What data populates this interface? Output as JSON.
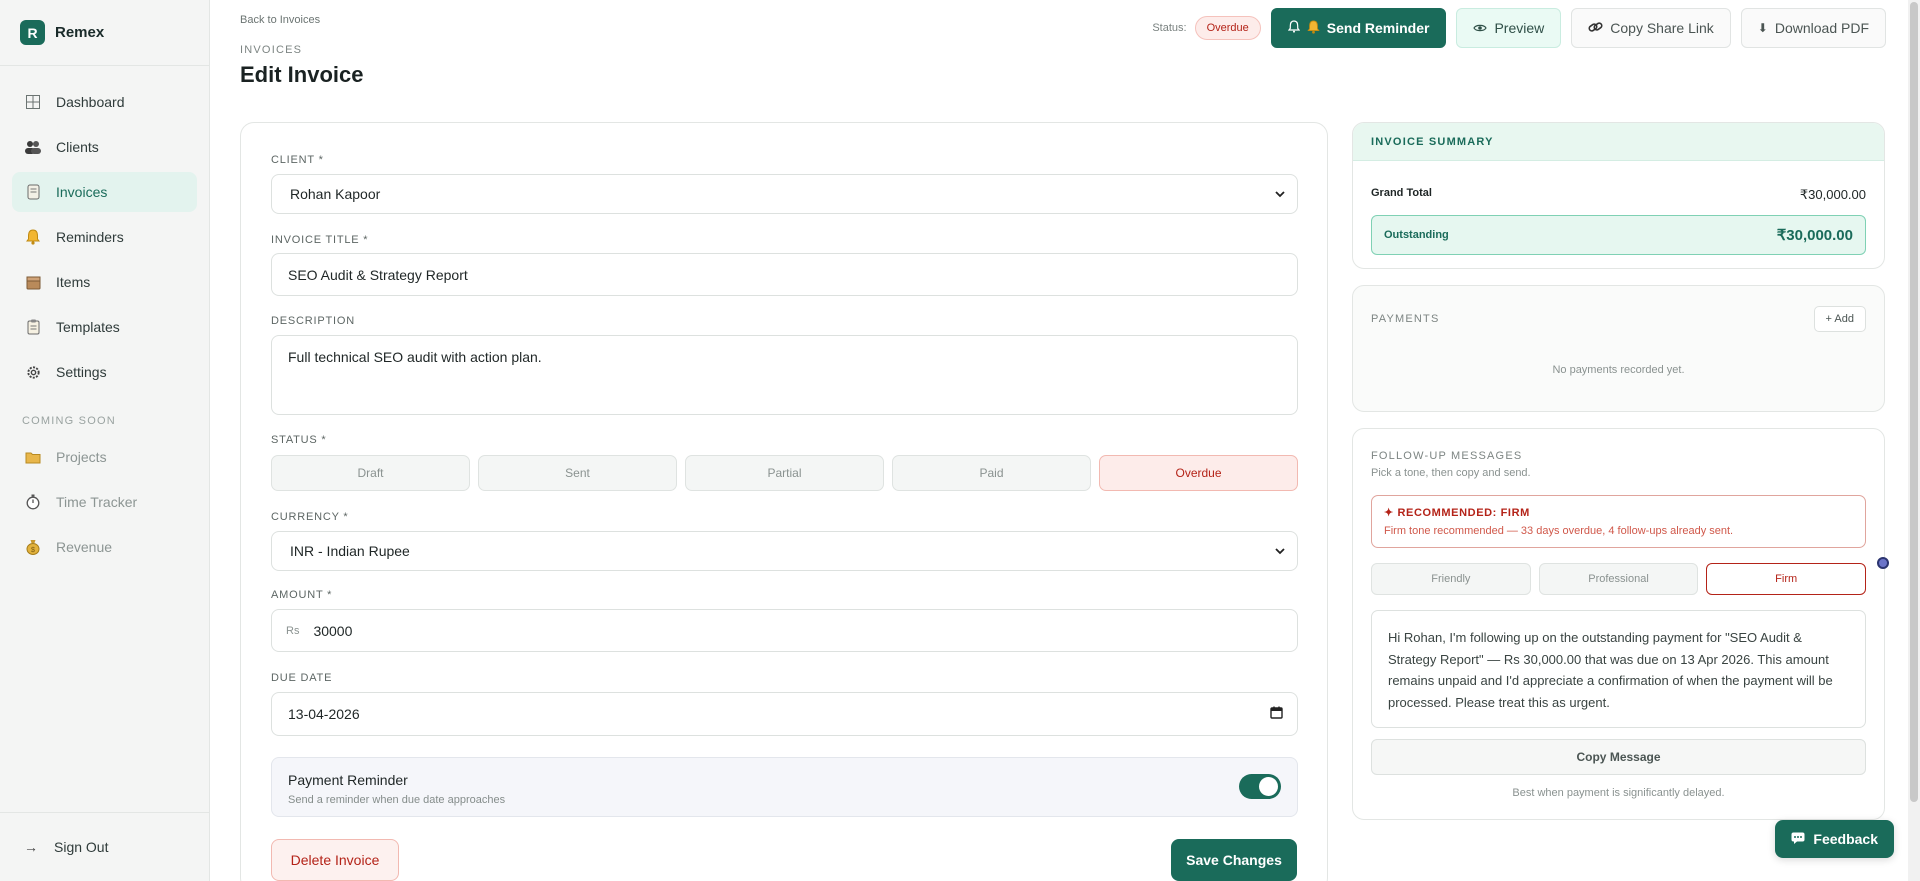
{
  "brand": {
    "logo_letter": "R",
    "name": "Remex"
  },
  "sidebar": {
    "items": [
      {
        "label": "Dashboard"
      },
      {
        "label": "Clients"
      },
      {
        "label": "Invoices"
      },
      {
        "label": "Reminders"
      },
      {
        "label": "Items"
      },
      {
        "label": "Templates"
      },
      {
        "label": "Settings"
      }
    ],
    "coming_soon_label": "COMING SOON",
    "coming_soon": [
      {
        "label": "Projects"
      },
      {
        "label": "Time Tracker"
      },
      {
        "label": "Revenue"
      }
    ],
    "sign_out": "Sign Out"
  },
  "header": {
    "back_link": "Back to Invoices",
    "breadcrumb": "INVOICES",
    "title": "Edit Invoice",
    "status_label": "Status:",
    "status_value": "Overdue",
    "send_reminder": "Send Reminder",
    "preview": "Preview",
    "copy_share_link": "Copy Share Link",
    "download_pdf": "Download PDF"
  },
  "form": {
    "client_label": "CLIENT *",
    "client_value": "Rohan Kapoor",
    "title_label": "INVOICE TITLE *",
    "title_value": "SEO Audit & Strategy Report",
    "description_label": "DESCRIPTION",
    "description_value": "Full technical SEO audit with action plan.",
    "status_label": "STATUS *",
    "status_options": [
      "Draft",
      "Sent",
      "Partial",
      "Paid",
      "Overdue"
    ],
    "status_selected": "Overdue",
    "currency_label": "CURRENCY *",
    "currency_value": "INR - Indian Rupee",
    "amount_label": "AMOUNT *",
    "amount_prefix": "Rs",
    "amount_value": "30000",
    "due_label": "DUE DATE",
    "due_value": "13-04-2026",
    "reminder_title": "Payment Reminder",
    "reminder_sub": "Send a reminder when due date approaches",
    "reminder_on": true,
    "delete_label": "Delete Invoice",
    "save_label": "Save Changes"
  },
  "summary": {
    "title": "INVOICE SUMMARY",
    "grand_total_label": "Grand Total",
    "grand_total_value": "₹30,000.00",
    "outstanding_label": "Outstanding",
    "outstanding_value": "₹30,000.00"
  },
  "payments": {
    "title": "PAYMENTS",
    "add_label": "+ Add",
    "empty_text": "No payments recorded yet."
  },
  "followup": {
    "title": "FOLLOW-UP MESSAGES",
    "subtitle": "Pick a tone, then copy and send.",
    "recommended_title": "✦ RECOMMENDED: FIRM",
    "recommended_text": "Firm tone recommended — 33 days overdue, 4 follow-ups already sent.",
    "tones": [
      "Friendly",
      "Professional",
      "Firm"
    ],
    "tone_selected": "Firm",
    "message": "Hi Rohan, I'm following up on the outstanding payment for \"SEO Audit & Strategy Report\" — Rs 30,000.00 that was due on 13 Apr 2026. This amount remains unpaid and I'd appreciate a confirmation of when the payment will be processed. Please treat this as urgent.",
    "copy_label": "Copy Message",
    "hint": "Best when payment is significantly delayed."
  },
  "feedback_label": "Feedback",
  "colors": {
    "accent": "#1a6b5a",
    "danger": "#b42318",
    "accent_light": "#e3f3ee"
  }
}
